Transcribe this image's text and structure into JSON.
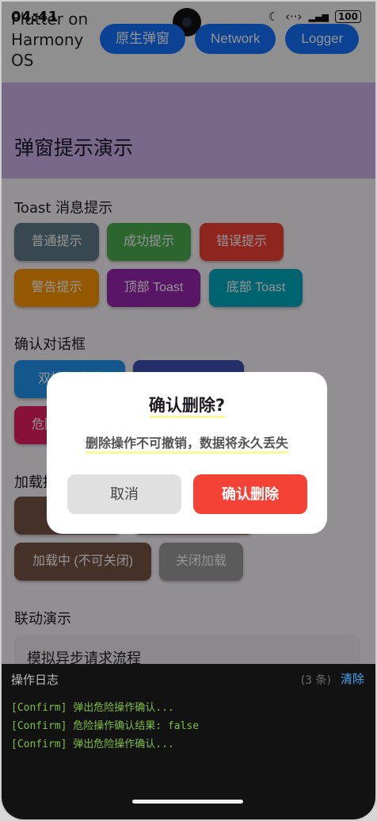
{
  "status": {
    "time": "04:41",
    "battery": "100",
    "moon_icon": "moon-icon",
    "signal_icon": "signal-icon"
  },
  "host": {
    "title": "Flutter on Harmony OS",
    "buttons": [
      "原生弹窗",
      "Network",
      "Logger"
    ]
  },
  "app": {
    "title": "弹窗提示演示",
    "toast": {
      "title": "Toast 消息提示",
      "buttons": [
        "普通提示",
        "成功提示",
        "错误提示",
        "警告提示",
        "顶部 Toast",
        "底部 Toast"
      ]
    },
    "confirm": {
      "title": "确认对话框",
      "buttons": [
        "双按钮确认",
        "",
        "危险操作确认"
      ]
    },
    "loading": {
      "title": "加载提示",
      "buttons": [
        "加载中",
        "",
        "加载中 (不可关闭)",
        "关闭加载"
      ]
    },
    "linkage": {
      "title": "联动演示",
      "card_label": "模拟异步请求流程"
    }
  },
  "dialog": {
    "title": "确认删除?",
    "message": "删除操作不可撤销，数据将永久丢失",
    "cancel": "取消",
    "confirm": "确认删除"
  },
  "log": {
    "title": "操作日志",
    "count": "(3 条)",
    "clear": "清除",
    "lines": [
      "[Confirm] 弹出危险操作确认...",
      "[Confirm] 危险操作确认结果: false",
      "[Confirm] 弹出危险操作确认..."
    ]
  }
}
